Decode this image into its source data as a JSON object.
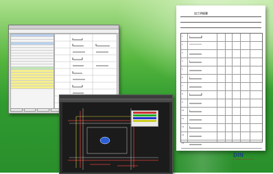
{
  "document": {
    "title": "加工明細書",
    "row_numbers": [
      "1",
      "2",
      "3",
      "4",
      "5",
      "6",
      "7",
      "8",
      "9",
      "10",
      "11",
      "12",
      "13",
      "14"
    ]
  },
  "logo": {
    "text": "DIN",
    "subtitle": "Construction System Software"
  },
  "colors": {
    "background_green": "#3aa33a",
    "cad_background": "#1b1b1b",
    "cad_accent_red": "#e0463b",
    "cad_accent_yellow": "#e8d23a",
    "logo_blue": "#183a8a"
  }
}
